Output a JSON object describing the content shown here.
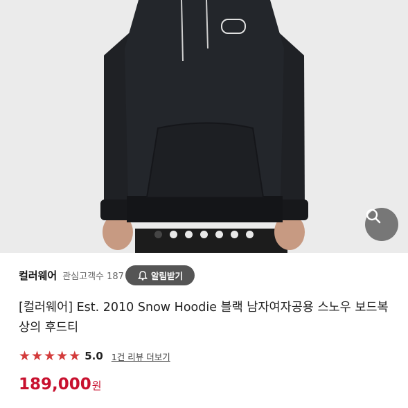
{
  "product": {
    "image_alt": "Snow Hoodie product photo",
    "carousel": {
      "count": 7,
      "active_index": 0
    },
    "seller_name": "컬러웨어",
    "interest_label": "관심고객수 187",
    "alarm_label": "알림받기",
    "title": "[컬러웨어] Est. 2010 Snow Hoodie 블랙 남자여자공용 스노우 보드복 상의 후드티",
    "rating_value": "5.0",
    "rating_stars": 5,
    "review_link": "1건 리뷰 더보기",
    "price_amount": "189,000",
    "price_unit": "원",
    "accent_color": "#c8102e",
    "star_color": "#d33b3b",
    "icons": [
      "search-icon",
      "bell-icon",
      "star-icon"
    ]
  }
}
